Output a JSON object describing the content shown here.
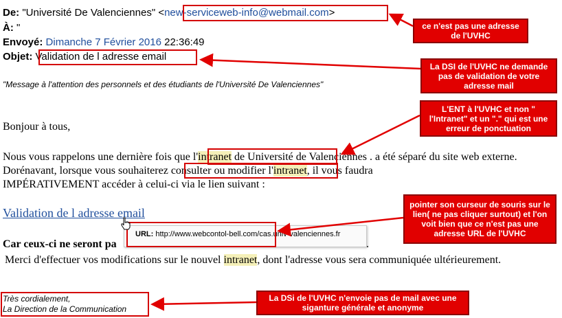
{
  "header": {
    "from_label": "De:",
    "from_name": "\"Université De Valenciennes\"",
    "from_email_open": "<",
    "from_email": "new-serviceweb-info@webmail.com",
    "from_email_close": ">",
    "to_label": "À:",
    "to_value": "\"",
    "sent_label": "Envoyé:",
    "sent_date": "Dimanche 7 Février 2016",
    "sent_time": "22:36:49",
    "subject_label": "Objet:",
    "subject_value": "Validation de l adresse email"
  },
  "body": {
    "intro_italic": "\"Message à l'attention des personnels et des étudiants de l'Université De Valenciennes\"",
    "greeting": "Bonjour à tous,",
    "p1_a": "Nous vous rappelons une dernière fois que",
    "p1_l": "l'",
    "p1_intranet": "intranet",
    "p1_b": "de Université de Valenciennes . a",
    "p1_c": "été séparé du site web externe.",
    "p2_a": "Dorénavant, lorsque vous souhaiterez",
    "p2_consult": "consulter ou modifier l'",
    "p2_intranet": "intranet",
    "p2_comma": ",",
    "p2_c": "il vous faudra",
    "p3": "IMPÉRATIVEMENT accéder à celui-ci via le lien suivant :",
    "link_text": "Validation de l adresse email",
    "bold_line": "Car ceux-ci ne seront pa",
    "tail_dot": ".",
    "merci_a": "Merci d'effectuer vos modifications sur le nouvel",
    "merci_intranet": "intranet",
    "merci_b": ", dont l'adresse vous sera communiquée ultérieurement."
  },
  "tooltip": {
    "label": "URL:",
    "url": "http://www.webcontol-bell.com/cas.univ-valenciennes.fr"
  },
  "signature": {
    "line1": "Très cordialement,",
    "line2": "La Direction de la Communication"
  },
  "callouts": {
    "c1": "ce n'est pas une adresse de l'UVHC",
    "c2": "La DSI de l'UVHC ne demande pas de validation de votre adresse mail",
    "c3": "L'ENT à l'UVHC et non \" l'Intranet\" et un \".\" qui est une erreur de ponctuation",
    "c4": "pointer son curseur de souris sur le lien( ne pas cliquer surtout) et l'on voit bien que ce n'est pas une adresse URL de l'UVHC",
    "c5": "La DSi de l'UVHC n'envoie pas de mail avec une siganture générale et anonyme"
  },
  "colors": {
    "annotation_red": "#e10000",
    "link_blue": "#1f4e9c",
    "highlight_yellow": "#f5f0b8"
  },
  "icons": {
    "cursor": "hand-pointer-icon"
  }
}
